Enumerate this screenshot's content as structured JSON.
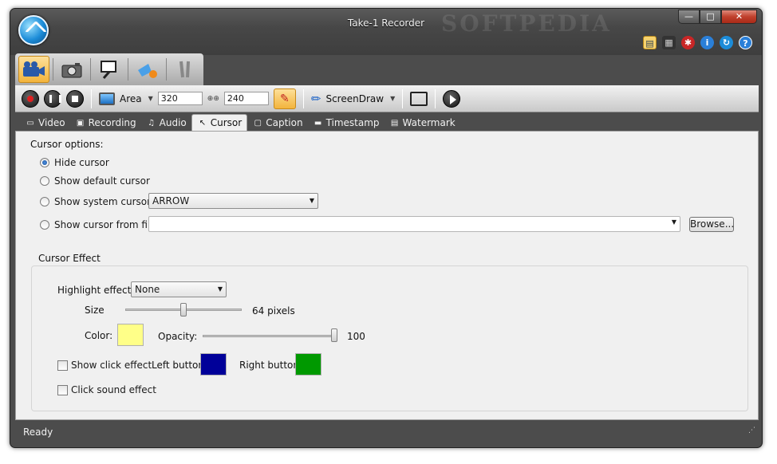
{
  "window": {
    "title": "Take-1 Recorder",
    "watermark": "SOFTPEDIA"
  },
  "win_controls": {
    "minimize": "—",
    "maximize": "□",
    "close": "✕"
  },
  "help_icons": [
    "window-icon",
    "film-icon",
    "bug-icon",
    "info-icon",
    "logo-icon",
    "help-icon"
  ],
  "modes": [
    "video-camera-icon",
    "photo-camera-icon",
    "zoom-tool-icon",
    "brush-tool-icon",
    "settings-tools-icon"
  ],
  "toolbar": {
    "area_label": "Area",
    "width_value": "320",
    "height_value": "240",
    "screendraw_label": "ScreenDraw"
  },
  "tabs": [
    {
      "label": "Video",
      "icon": "video-icon"
    },
    {
      "label": "Recording",
      "icon": "recording-icon"
    },
    {
      "label": "Audio",
      "icon": "audio-icon"
    },
    {
      "label": "Cursor",
      "icon": "cursor-icon",
      "active": true
    },
    {
      "label": "Caption",
      "icon": "caption-icon"
    },
    {
      "label": "Timestamp",
      "icon": "timestamp-icon"
    },
    {
      "label": "Watermark",
      "icon": "watermark-icon"
    }
  ],
  "cursor_options": {
    "heading": "Cursor options:",
    "hide_cursor": "Hide cursor",
    "show_default": "Show default cursor",
    "show_system": "Show system cursor",
    "system_cursor_value": "ARROW",
    "show_from_file": "Show cursor from file",
    "file_value": "",
    "browse": "Browse..."
  },
  "cursor_effect": {
    "heading": "Cursor Effect",
    "highlight_label": "Highlight effect:",
    "highlight_value": "None",
    "size_label": "Size",
    "size_value": "64 pixels",
    "size_fraction": 0.5,
    "color_label": "Color:",
    "color_hex": "#ffff88",
    "opacity_label": "Opacity:",
    "opacity_value": "100",
    "opacity_fraction": 1.0,
    "show_click_effect": "Show click effect",
    "left_button_label": "Left button:",
    "left_button_color": "#000099",
    "right_button_label": "Right button:",
    "right_button_color": "#009900",
    "click_sound": "Click sound effect"
  },
  "status": {
    "text": "Ready"
  }
}
